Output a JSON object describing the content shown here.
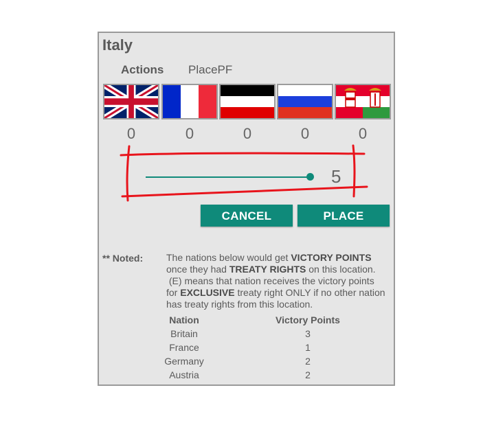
{
  "dialog": {
    "title": "Italy",
    "actions_label": "Actions",
    "actions_value": "PlacePF"
  },
  "nations": [
    {
      "name": "Britain",
      "flag_icon": "uk-flag-icon",
      "count": "0"
    },
    {
      "name": "France",
      "flag_icon": "france-flag-icon",
      "count": "0"
    },
    {
      "name": "Germany",
      "flag_icon": "germany-flag-icon",
      "count": "0"
    },
    {
      "name": "Russia",
      "flag_icon": "russia-flag-icon",
      "count": "0"
    },
    {
      "name": "Austria",
      "flag_icon": "austria-hungary-flag-icon",
      "count": "0"
    }
  ],
  "slider": {
    "value": "5",
    "level": 1.0,
    "accent_color": "#0f8a7a"
  },
  "buttons": {
    "cancel_label": "CANCEL",
    "place_label": "PLACE"
  },
  "note": {
    "label": "** Noted:",
    "line1_pre": "The nations below would get ",
    "line1_bold": "VICTORY POINTS",
    "line2_pre": "once they had ",
    "line2_bold": "TREATY RIGHTS",
    "line2_post": " on this location.",
    "line3": " (E) means that nation receives the victory points",
    "line4_pre": "for ",
    "line4_bold": "EXCLUSIVE",
    "line4_post": " treaty right ONLY if no other nation",
    "line5": "has treaty rights from this location."
  },
  "table": {
    "headers": [
      "Nation",
      "Victory Points"
    ],
    "rows": [
      {
        "nation": "Britain",
        "points": "3"
      },
      {
        "nation": "France",
        "points": "1"
      },
      {
        "nation": "Germany",
        "points": "2"
      },
      {
        "nation": "Austria",
        "points": "2"
      }
    ]
  }
}
